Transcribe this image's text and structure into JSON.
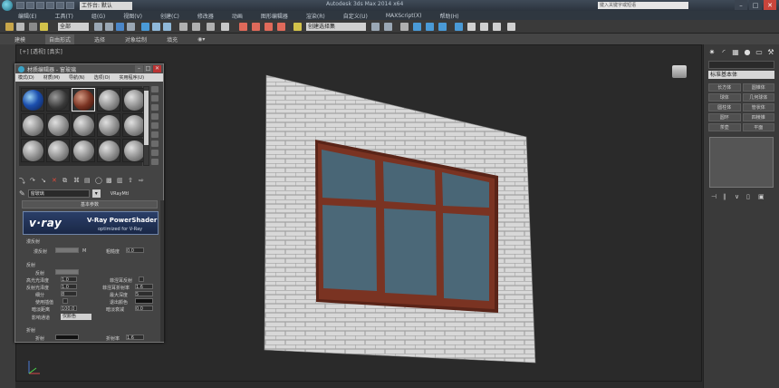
{
  "titlebar": {
    "workspace": "工作台: 默认",
    "title": "Autodesk 3ds Max 2014 x64",
    "search_placeholder": "键入关键字或短语",
    "min": "–",
    "max": "□",
    "close": "✕"
  },
  "menu": {
    "items": [
      "编辑(E)",
      "工具(T)",
      "组(G)",
      "视图(V)",
      "创建(C)",
      "修改器",
      "动画",
      "图形编辑器",
      "渲染(R)",
      "自定义(U)",
      "MAXScript(X)",
      "帮助(H)"
    ]
  },
  "toolbar": {
    "selection_filter": "全部",
    "named_selection": "创建选择集"
  },
  "ribbon": {
    "tabs": [
      "建模",
      "自由形式",
      "选择",
      "对象绘制",
      "填充"
    ],
    "active_index": 1
  },
  "viewport": {
    "label": "[+] [透视] [真实]",
    "colors": {
      "wall": "#dcdcdc",
      "mortar": "#9c9c9c",
      "frame": "#6b2a1a",
      "glass": "#4d6a7a"
    }
  },
  "material_editor": {
    "title": "材质编辑器 - 窗玻璃",
    "menu": [
      "模式(D)",
      "材质(M)",
      "导航(N)",
      "选项(O)",
      "实用程序(U)"
    ],
    "material_name": "窗玻璃",
    "material_type": "VRayMtl",
    "rollout": "基本参数",
    "vray_logo": "v·ray",
    "vray_title": "V-Ray PowerShader",
    "vray_subtitle": "optimized for V-Ray",
    "section_diffuse": "漫反射",
    "diffuse_label": "漫反射",
    "diffuse_value": "M",
    "roughness_label": "粗糙度",
    "roughness_value": "0.0",
    "section_reflect": "反射",
    "reflect_label": "反射",
    "hilight_gloss_label": "高光光泽度",
    "hilight_gloss_value": "1.0",
    "fresnel_label": "菲涅耳反射",
    "refl_gloss_label": "反射光泽度",
    "refl_gloss_value": "1.0",
    "fresnel_ior_label": "菲涅耳折射率",
    "fresnel_ior_value": "1.6",
    "subdivs_label": "细分",
    "subdivs_value": "8",
    "max_depth_label": "最大深度",
    "max_depth_value": "5",
    "use_interp_label": "使用插值",
    "exit_color_label": "退出颜色",
    "dim_dist_label": "暗淡距离",
    "dim_dist_value": "100.0",
    "dim_falloff_label": "暗淡衰减",
    "dim_falloff_value": "0.0",
    "affect_channels_label": "影响通道",
    "affect_channels_value": "仅颜色",
    "section_refract": "折射",
    "refract_label": "折射",
    "ior_label": "折射率",
    "ior_value": "1.6"
  },
  "command_panel": {
    "object_type_combo": "标准基本体",
    "buttons": [
      "长方体",
      "圆锥体",
      "球体",
      "几何球体",
      "圆柱体",
      "管状体",
      "圆环",
      "四棱锥",
      "茶壶",
      "平面"
    ],
    "tab_icons": [
      "sun-icon",
      "arc-icon",
      "hierarchy-icon",
      "circle-icon",
      "display-icon",
      "wrench-icon"
    ]
  }
}
